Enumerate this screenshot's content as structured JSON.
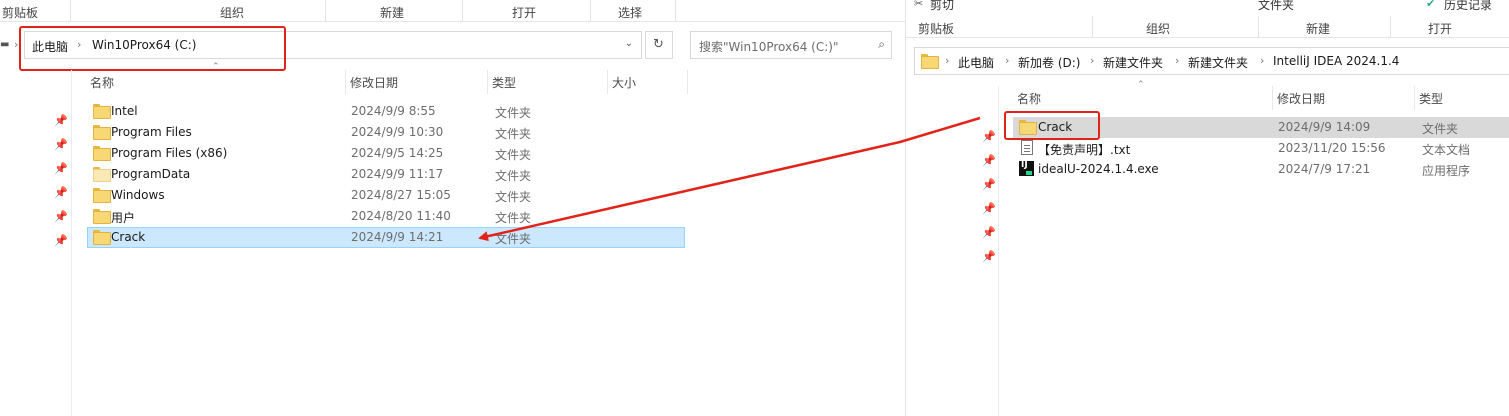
{
  "left": {
    "ribbon": [
      "剪贴板",
      "组织",
      "新建",
      "打开",
      "选择"
    ],
    "breadcrumbs": [
      "此电脑",
      "Win10Prox64 (C:)"
    ],
    "search_placeholder": "搜索\"Win10Prox64 (C:)\"",
    "columns": [
      "名称",
      "修改日期",
      "类型",
      "大小"
    ],
    "rows": [
      {
        "name": "Intel",
        "date": "2024/9/9 8:55",
        "type": "文件夹"
      },
      {
        "name": "Program Files",
        "date": "2024/9/9 10:30",
        "type": "文件夹"
      },
      {
        "name": "Program Files (x86)",
        "date": "2024/9/5 14:25",
        "type": "文件夹"
      },
      {
        "name": "ProgramData",
        "date": "2024/9/9 11:17",
        "type": "文件夹"
      },
      {
        "name": "Windows",
        "date": "2024/8/27 15:05",
        "type": "文件夹"
      },
      {
        "name": "用户",
        "date": "2024/8/20 11:40",
        "type": "文件夹"
      },
      {
        "name": "Crack",
        "date": "2024/9/9 14:21",
        "type": "文件夹"
      }
    ]
  },
  "right": {
    "ribbon_top": [
      "剪切",
      "文件夹",
      "历史记录"
    ],
    "ribbon": [
      "剪贴板",
      "组织",
      "新建",
      "打开"
    ],
    "breadcrumbs": [
      "此电脑",
      "新加卷 (D:)",
      "新建文件夹",
      "新建文件夹",
      "IntelliJ IDEA  2024.1.4"
    ],
    "columns": [
      "名称",
      "修改日期",
      "类型"
    ],
    "rows": [
      {
        "name": "Crack",
        "date": "2024/9/9 14:09",
        "type": "文件夹"
      },
      {
        "name": "【免责声明】.txt",
        "date": "2023/11/20 15:56",
        "type": "文本文档"
      },
      {
        "name": "idealU-2024.1.4.exe",
        "date": "2024/7/9 17:21",
        "type": "应用程序"
      }
    ],
    "exe_icon_text": "IJ"
  },
  "colors": {
    "annotation_red": "#e2231a",
    "selection": "#cce8ff",
    "folder": "#f8d775"
  }
}
